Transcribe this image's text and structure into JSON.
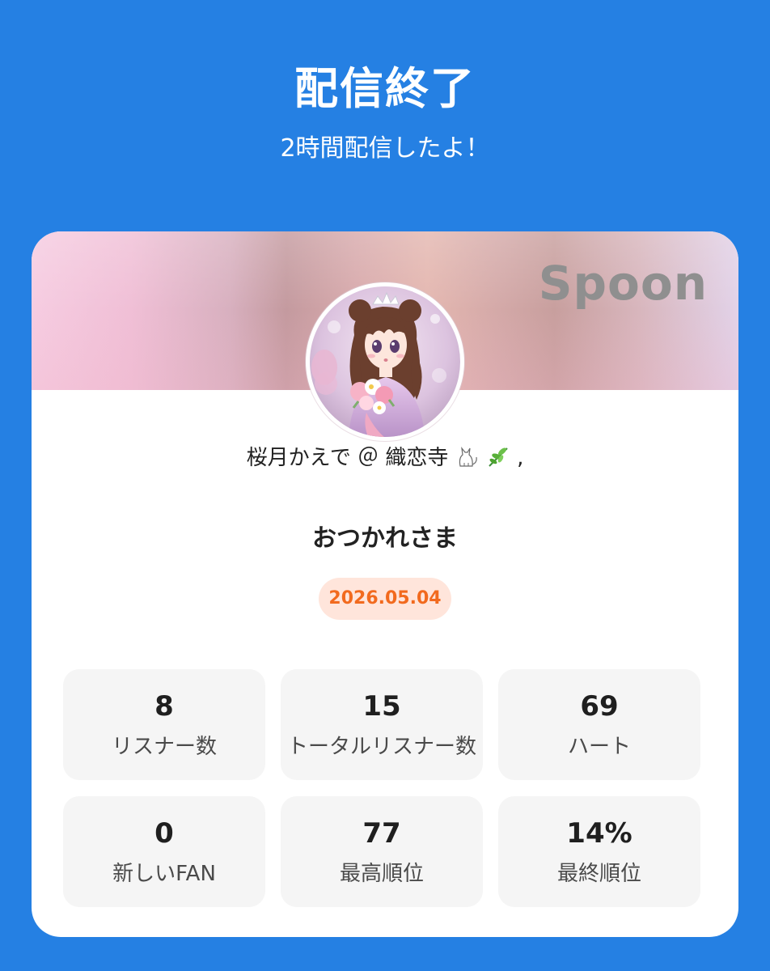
{
  "header": {
    "title": "配信終了",
    "subtitle": "2時間配信したよ！"
  },
  "card": {
    "brand_logo": "Spoon",
    "avatar_icon": "profile-avatar-anime-girl",
    "user_name": "桜月かえで ＠ 織恋寺",
    "user_name_suffix": ",",
    "message": "おつかれさま",
    "date": "2026.05.04"
  },
  "stats": [
    {
      "value": "8",
      "label": "リスナー数"
    },
    {
      "value": "15",
      "label": "トータルリスナー数"
    },
    {
      "value": "69",
      "label": "ハート"
    },
    {
      "value": "0",
      "label": "新しいFAN"
    },
    {
      "value": "77",
      "label": "最高順位"
    },
    {
      "value": "14%",
      "label": "最終順位"
    }
  ],
  "colors": {
    "background": "#2580e3",
    "card": "#ffffff",
    "tile": "#f5f5f5",
    "date_text": "#f26a1e",
    "date_badge": "#ffe5db",
    "logo": "#8f8f8f"
  }
}
